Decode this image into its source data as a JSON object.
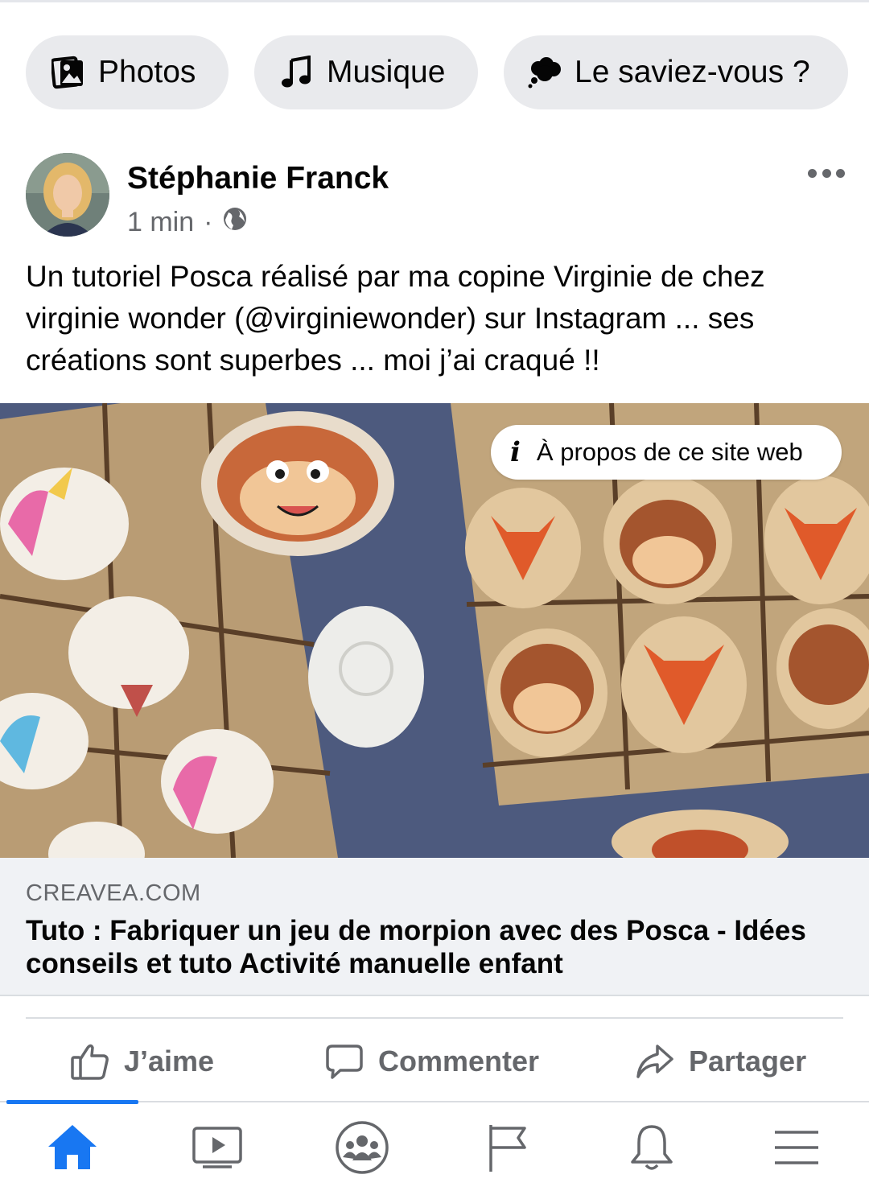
{
  "shortcuts": [
    {
      "label": "Photos",
      "icon": "photos-icon"
    },
    {
      "label": "Musique",
      "icon": "music-note-icon"
    },
    {
      "label": "Le saviez-vous ?",
      "icon": "thought-bubble-icon"
    }
  ],
  "post": {
    "author": "Stéphanie Franck",
    "time": "1 min",
    "separator": "·",
    "audience_icon": "globe-icon",
    "text": "Un tutoriel Posca réalisé par ma copine Virginie de chez virginie wonder (@virginiewonder) sur Instagram ... ses créations sont superbes ... moi j’ai craqué !!",
    "about_label": "À propos de ce site web",
    "link": {
      "domain": "CREAVEA.COM",
      "title": "Tuto : Fabriquer un jeu de morpion avec des Posca - Idées conseils et tuto Activité manuelle enfant"
    }
  },
  "actions": {
    "like": "J’aime",
    "comment": "Commenter",
    "share": "Partager"
  },
  "nav": {
    "items": [
      "home-icon",
      "watch-icon",
      "groups-icon",
      "pages-flag-icon",
      "notifications-bell-icon",
      "menu-icon"
    ],
    "active": "home-icon",
    "active_color": "#1877f2",
    "inactive_color": "#65676b"
  }
}
